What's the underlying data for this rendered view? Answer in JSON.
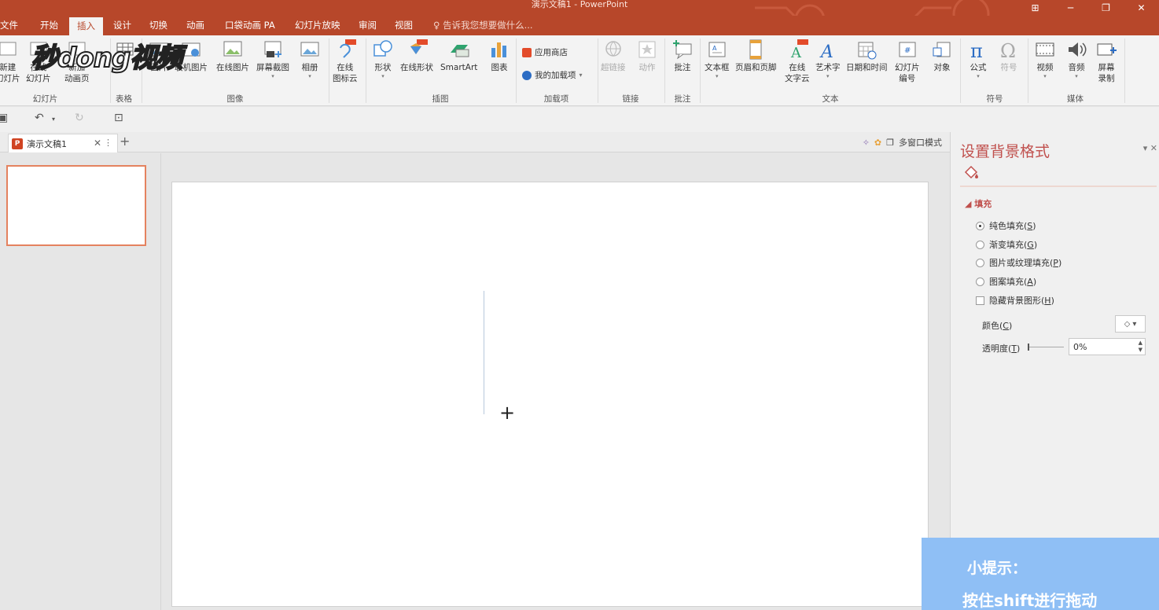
{
  "titlebar": {
    "title": "演示文稿1 - PowerPoint"
  },
  "menu": {
    "tabs": [
      "文件",
      "开始",
      "插入",
      "设计",
      "切换",
      "动画",
      "口袋动画 PA",
      "幻灯片放映",
      "审阅",
      "视图"
    ],
    "active": "插入",
    "tellme": "告诉我您想要做什么..."
  },
  "ribbon": {
    "slides_group": {
      "new_slide": "新建\n幻灯片",
      "online": "在线\n幻灯片",
      "new_anim": "新加\n动画页",
      "name": "幻灯片"
    },
    "table_group": {
      "name": "表格"
    },
    "images_group": {
      "picture": "图片",
      "online_pics": "联机图片",
      "online_image": "在线图片",
      "screenshot": "屏幕截图",
      "album": "相册",
      "name": "图像"
    },
    "icons_cloud": "在线\n图标云",
    "illus_group": {
      "shapes": "形状",
      "online_shapes": "在线形状",
      "smartart": "SmartArt",
      "chart": "图表",
      "name": "插图"
    },
    "addins_group": {
      "store": "应用商店",
      "my_addins": "我的加载项",
      "name": "加载项"
    },
    "links_group": {
      "hyperlink": "超链接",
      "action": "动作",
      "name": "链接"
    },
    "comments_group": {
      "comment": "批注",
      "name": "批注"
    },
    "text_group": {
      "textbox": "文本框",
      "header_footer": "页眉和页脚",
      "online_text": "在线\n文字云",
      "wordart": "艺术字",
      "datetime": "日期和时间",
      "slide_number": "幻灯片\n编号",
      "object": "对象",
      "name": "文本"
    },
    "symbols_group": {
      "equation": "公式",
      "symbol": "符号",
      "name": "符号"
    },
    "media_group": {
      "video": "视频",
      "audio": "音频",
      "screen_rec": "屏幕\n录制",
      "name": "媒体"
    }
  },
  "doctabs": {
    "tab_title": "演示文稿1",
    "multiwindow": "多窗口模式"
  },
  "pane": {
    "title": "设置背景格式",
    "section": "填充",
    "options": [
      {
        "label": "纯色填充(",
        "key": "S",
        "checked": true
      },
      {
        "label": "渐变填充(",
        "key": "G",
        "checked": false
      },
      {
        "label": "图片或纹理填充(",
        "key": "P",
        "checked": false
      },
      {
        "label": "图案填充(",
        "key": "A",
        "checked": false
      }
    ],
    "hide_bg": {
      "label": "隐藏背景图形(",
      "key": "H"
    },
    "color": {
      "label": "颜色(",
      "key": "C"
    },
    "transparency": {
      "label": "透明度(",
      "key": "T",
      "value": "0%"
    }
  },
  "watermark": "秒dong视频",
  "tip": {
    "line1": "小提示：",
    "line2": "按住shift进行拖动"
  },
  "colors": {
    "accent": "#b7472a",
    "tip_bg": "#8fbff5",
    "pane_title": "#c0504d"
  }
}
